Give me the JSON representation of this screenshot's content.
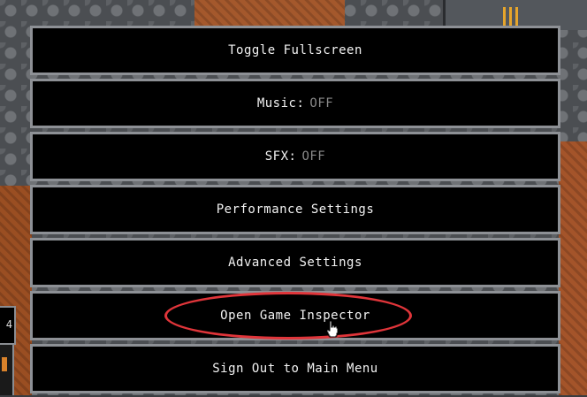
{
  "menu": {
    "items": [
      {
        "label": "Toggle Fullscreen",
        "state": ""
      },
      {
        "label": "Music:",
        "state": "OFF"
      },
      {
        "label": "SFX:",
        "state": "OFF"
      },
      {
        "label": "Performance Settings",
        "state": ""
      },
      {
        "label": "Advanced Settings",
        "state": ""
      },
      {
        "label": "Open Game Inspector",
        "state": ""
      },
      {
        "label": "Sign Out to Main Menu",
        "state": ""
      }
    ]
  },
  "side_hud": {
    "value": "4"
  },
  "colors": {
    "menu_background": "#000000",
    "menu_border": "#8d9095",
    "menu_text": "#f2f2f2",
    "state_text": "#8a8a8a",
    "highlight": "#e0353a"
  },
  "icons": {
    "cursor": "hand-pointer-icon"
  }
}
